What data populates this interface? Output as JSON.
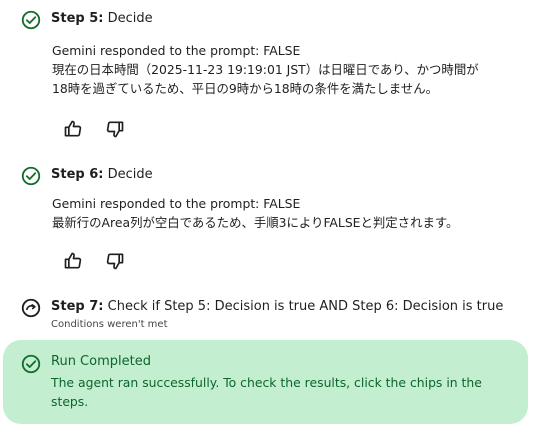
{
  "steps": [
    {
      "number_label": "Step 5:",
      "title": "Decide",
      "response_label": "Gemini responded to the prompt: FALSE",
      "response_lines": [
        "現在の日本時間（2025-11-23 19:19:01 JST）は日曜日であり、かつ時間が",
        "18時を過ぎているため、平日の9時から18時の条件を満たしません。"
      ],
      "status_icon": "check-circle-icon"
    },
    {
      "number_label": "Step 6:",
      "title": "Decide",
      "response_label": "Gemini responded to the prompt: FALSE",
      "response_lines": [
        "最新行のArea列が空白であるため、手順3によりFALSEと判定されます。"
      ],
      "status_icon": "check-circle-icon"
    },
    {
      "number_label": "Step 7:",
      "title": "Check if Step 5: Decision is true AND Step 6: Decision is true",
      "note": "Conditions weren't met",
      "status_icon": "skipped-circle-icon"
    }
  ],
  "run": {
    "title": "Run Completed",
    "description": "The agent ran successfully. To check the results, click the chips in the steps."
  },
  "colors": {
    "success_green": "#146c2e",
    "banner_bg": "#c4eed0",
    "text": "#1f1f1f"
  }
}
